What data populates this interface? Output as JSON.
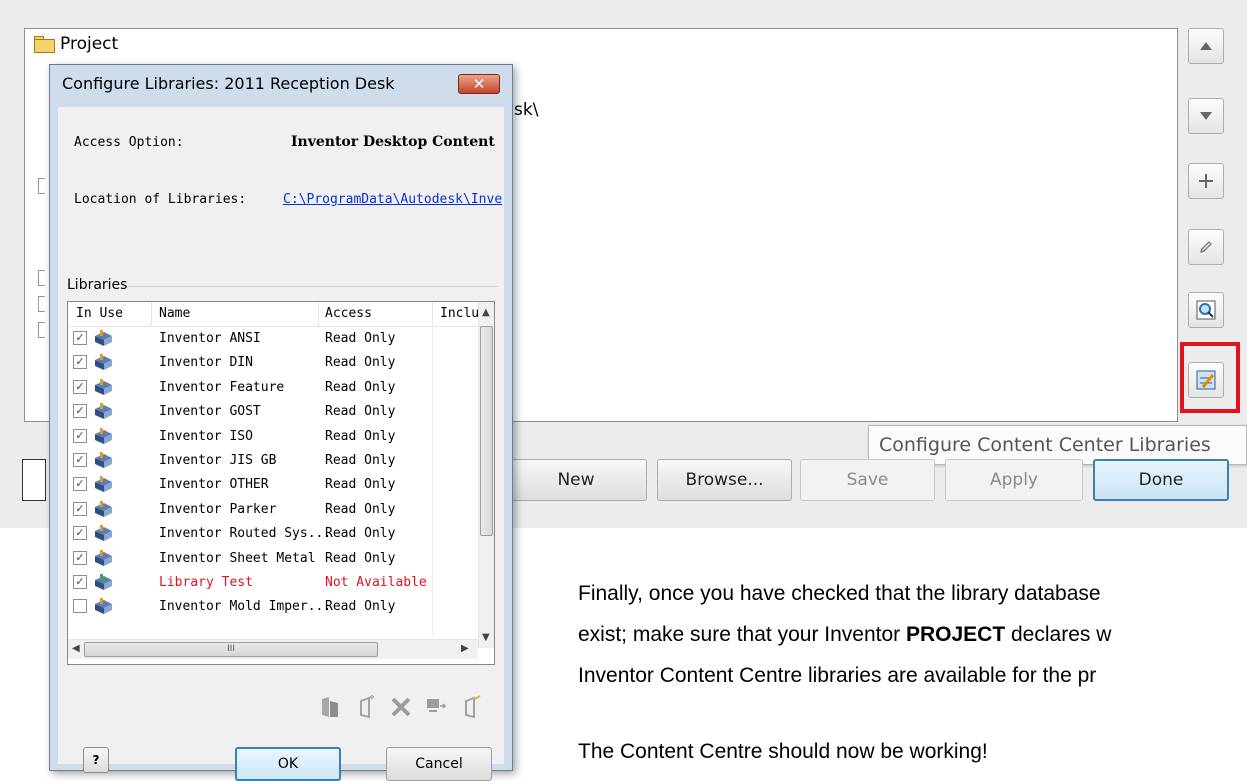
{
  "project_window": {
    "root_label": "Project",
    "path_fragment": "sk\\",
    "buttons": {
      "new": "New",
      "browse": "Browse...",
      "save": "Save",
      "apply": "Apply",
      "done": "Done"
    },
    "tooltip": "Configure Content Center Libraries",
    "highlight_color": "#e0141c"
  },
  "dialog": {
    "title": "Configure Libraries: 2011 Reception Desk",
    "close_glyph": "✕",
    "access_option_label": "Access Option:",
    "access_option_value": "Inventor Desktop Content",
    "location_label": "Location of Libraries:",
    "location_value": "C:\\ProgramData\\Autodesk\\Inve",
    "libraries_legend": "Libraries",
    "columns": [
      "In Use",
      "Name",
      "Access",
      "Inclu"
    ],
    "rows": [
      {
        "in_use": true,
        "name": "Inventor ANSI",
        "access": "Read Only"
      },
      {
        "in_use": true,
        "name": "Inventor DIN",
        "access": "Read Only"
      },
      {
        "in_use": true,
        "name": "Inventor Feature",
        "access": "Read Only"
      },
      {
        "in_use": true,
        "name": "Inventor GOST",
        "access": "Read Only"
      },
      {
        "in_use": true,
        "name": "Inventor ISO",
        "access": "Read Only"
      },
      {
        "in_use": true,
        "name": "Inventor JIS GB",
        "access": "Read Only"
      },
      {
        "in_use": true,
        "name": "Inventor OTHER",
        "access": "Read Only"
      },
      {
        "in_use": true,
        "name": "Inventor Parker",
        "access": "Read Only"
      },
      {
        "in_use": true,
        "name": "Inventor Routed Sys...",
        "access": "Read Only"
      },
      {
        "in_use": true,
        "name": "Inventor Sheet Metal",
        "access": "Read Only"
      },
      {
        "in_use": true,
        "name": "Library Test",
        "access": "Not Available",
        "status": "error"
      },
      {
        "in_use": false,
        "name": "Inventor Mold Imper...",
        "access": "Read Only"
      }
    ],
    "scroll_thumb_grip": "III",
    "ok_label": "OK",
    "cancel_label": "Cancel",
    "help_glyph": "?"
  },
  "article": {
    "line1": "Finally, once you have checked that the library database",
    "line2_before": "exist; make sure that your Inventor ",
    "line2_bold": "PROJECT",
    "line2_after": " declares w",
    "line3": "Inventor Content Centre libraries are available for the pr",
    "line4": "The Content Centre should now be working!"
  }
}
